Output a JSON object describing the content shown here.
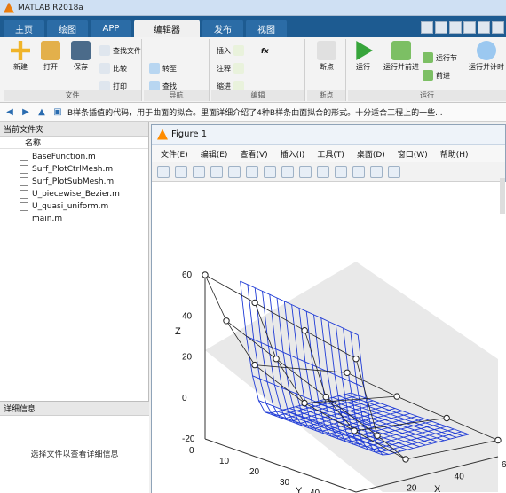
{
  "window": {
    "title": "MATLAB R2018a"
  },
  "tabs": [
    "主页",
    "绘图",
    "APP",
    "编辑器",
    "发布",
    "视图"
  ],
  "ribbon": {
    "groups": [
      {
        "title": "文件",
        "buttons": [
          {
            "label": "新建"
          },
          {
            "label": "打开"
          },
          {
            "label": "保存"
          }
        ],
        "small": [
          {
            "label": "查找文件"
          },
          {
            "label": "比较"
          },
          {
            "label": "打印"
          }
        ]
      },
      {
        "title": "导航",
        "small": [
          {
            "label": "转至"
          },
          {
            "label": "查找"
          }
        ]
      },
      {
        "title": "编辑",
        "small": [
          {
            "label": "插入"
          },
          {
            "label": "注释"
          },
          {
            "label": "缩进"
          }
        ]
      },
      {
        "title": "断点",
        "buttons": [
          {
            "label": "断点"
          }
        ]
      },
      {
        "title": "运行",
        "buttons": [
          {
            "label": "运行"
          },
          {
            "label": "运行并前进"
          },
          {
            "label": "运行节"
          },
          {
            "label": "前进"
          },
          {
            "label": "运行并计时"
          }
        ]
      }
    ]
  },
  "address": {
    "path": "B样条插值的代码，用于曲面的拟合。里面详细介绍了4种B样条曲面拟合的形式。十分适合工程上的一些..."
  },
  "current_folder": {
    "header": "当前文件夹",
    "column_name": "名称",
    "files": [
      "BaseFunction.m",
      "Surf_PlotCtrlMesh.m",
      "Surf_PlotSubMesh.m",
      "U_piecewise_Bezier.m",
      "U_quasi_uniform.m",
      "main.m"
    ]
  },
  "details": {
    "header": "详细信息",
    "message": "选择文件以查看详细信息"
  },
  "figure": {
    "title": "Figure 1",
    "menu": [
      "文件(E)",
      "编辑(E)",
      "查看(V)",
      "插入(I)",
      "工具(T)",
      "桌面(D)",
      "窗口(W)",
      "帮助(H)"
    ]
  },
  "chart_data": {
    "type": "scatter",
    "title": "",
    "xlabel": "X",
    "ylabel": "Y",
    "zlabel": "Z",
    "z_ticks": [
      -20,
      0,
      20,
      40,
      60
    ],
    "y_ticks": [
      0,
      10,
      20,
      30,
      40,
      50
    ],
    "x_ticks": [
      0,
      20,
      40,
      60
    ],
    "series": [
      {
        "type": "surface",
        "color": "#1f3bd6"
      },
      {
        "type": "control-mesh",
        "color": "#222222"
      }
    ]
  },
  "colors": {
    "tabbar": "#1d5b91",
    "active_tab": "#f0f0f0",
    "surface": "#1f3bd6",
    "ctrl": "#222222"
  }
}
